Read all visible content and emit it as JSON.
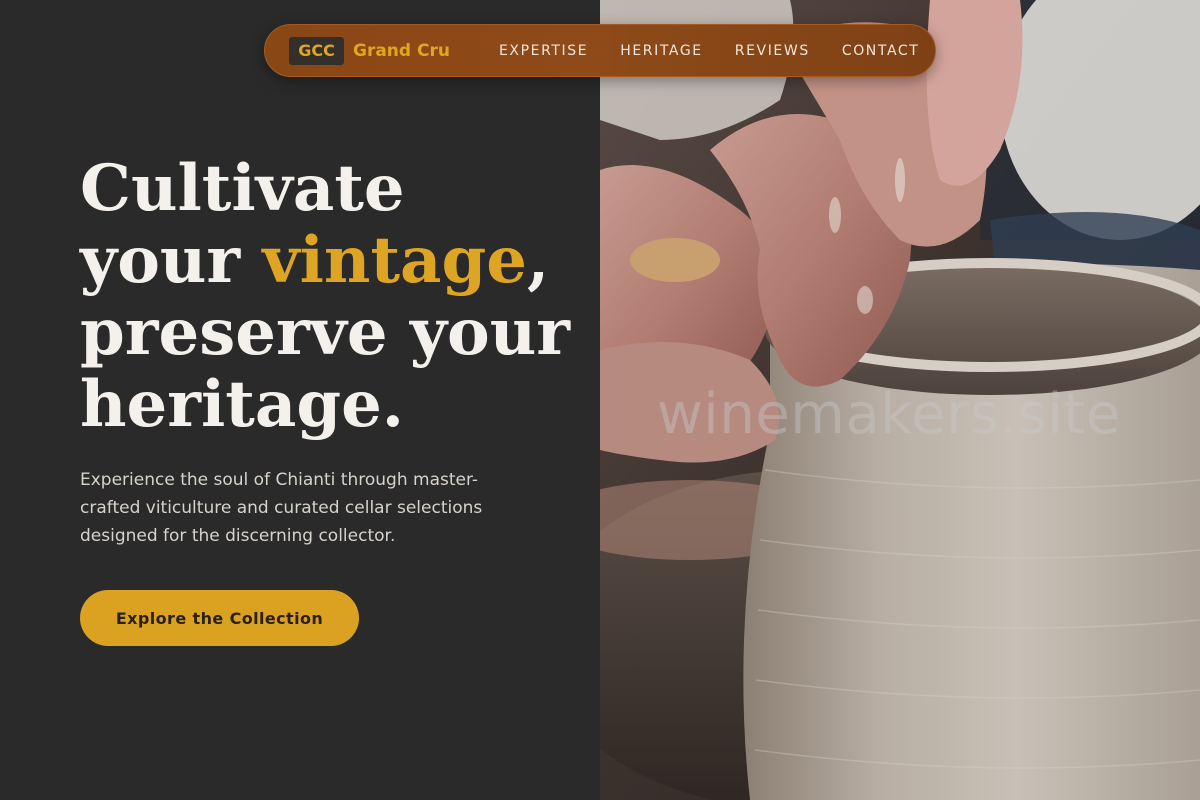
{
  "brand": {
    "badge": "GCC",
    "name": "Grand Cru"
  },
  "nav": {
    "links": [
      {
        "label": "EXPERTISE"
      },
      {
        "label": "HERITAGE"
      },
      {
        "label": "REVIEWS"
      },
      {
        "label": "CONTACT"
      }
    ]
  },
  "hero": {
    "headline_part1": "Cultivate your ",
    "headline_accent": "vintage",
    "headline_part2": ", preserve your heritage.",
    "subtext": "Experience the soul of Chianti through master-crafted viticulture and curated cellar selections designed for the discerning collector.",
    "cta_label": "Explore the Collection"
  },
  "image": {
    "watermark": "winemakers.site"
  },
  "colors": {
    "accent": "#dea524",
    "background": "#2a2a2a",
    "nav_bar": "#8a4716",
    "cta": "#dba221"
  }
}
